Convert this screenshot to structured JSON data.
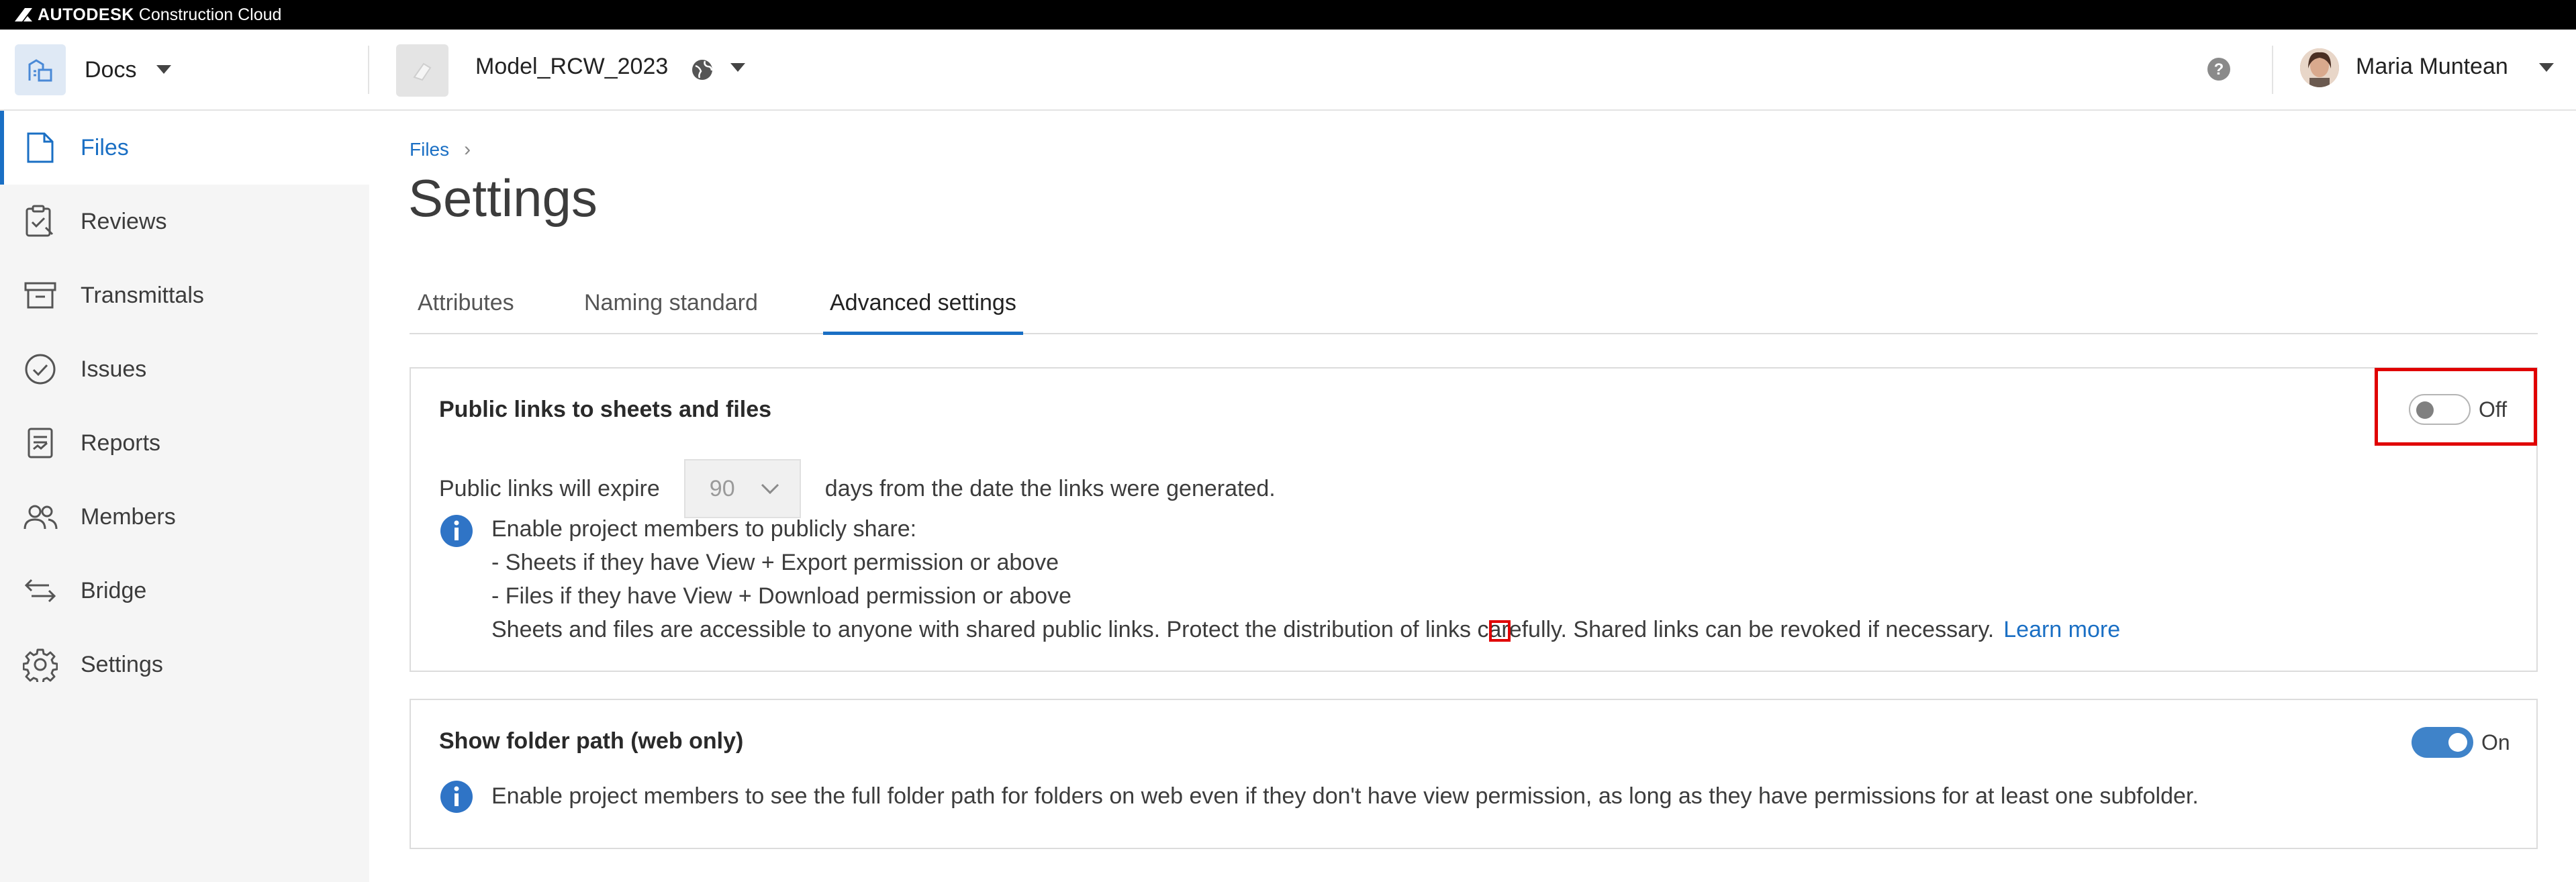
{
  "topbar": {
    "brand_bold": "AUTODESK",
    "brand_rest": " Construction Cloud"
  },
  "header": {
    "module": "Docs",
    "project": "Model_RCW_2023",
    "user": "Maria Muntean"
  },
  "sidebar": {
    "items": [
      {
        "label": "Files",
        "icon": "file-icon",
        "active": true
      },
      {
        "label": "Reviews",
        "icon": "clipboard-check-icon"
      },
      {
        "label": "Transmittals",
        "icon": "archive-box-icon"
      },
      {
        "label": "Issues",
        "icon": "check-circle-icon"
      },
      {
        "label": "Reports",
        "icon": "report-icon"
      },
      {
        "label": "Members",
        "icon": "people-icon"
      },
      {
        "label": "Bridge",
        "icon": "bridge-arrows-icon"
      },
      {
        "label": "Settings",
        "icon": "gear-icon"
      }
    ]
  },
  "main": {
    "breadcrumb": "Files",
    "title": "Settings",
    "tabs": [
      {
        "label": "Attributes"
      },
      {
        "label": "Naming standard"
      },
      {
        "label": "Advanced settings",
        "active": true
      }
    ],
    "public_links": {
      "title": "Public links to sheets and files",
      "toggle_label": "Off",
      "toggle_state": "off",
      "expire_prefix": "Public links will expire",
      "expire_value": "90",
      "expire_suffix": "days from the date the links were generated.",
      "info": {
        "line1": "Enable project members to publicly share:",
        "line2": "- Sheets if they have View + Export permission or above",
        "line3": "- Files if they have View + Download permission or above",
        "line4": "Sheets and files are accessible to anyone with shared public links. Protect the distribution of links carefully. Shared links can be revoked if necessary.",
        "learn_more": "Learn more"
      }
    },
    "folder_path": {
      "title": "Show folder path (web only)",
      "toggle_label": "On",
      "toggle_state": "on",
      "info": "Enable project members to see the full folder path for folders on web even if they don't have view permission, as long as they have permissions for at least one subfolder."
    }
  },
  "colors": {
    "accent": "#1a6fc4",
    "toggle_on": "#3f83c9",
    "highlight": "#e00000"
  }
}
